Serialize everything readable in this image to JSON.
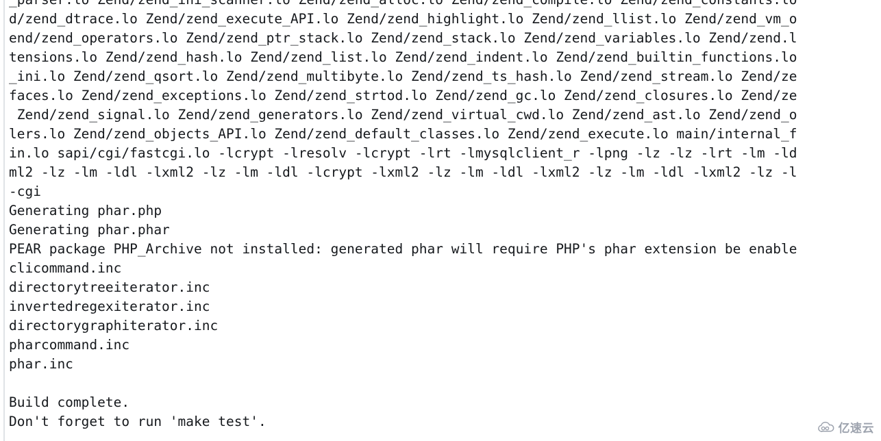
{
  "terminal": {
    "lines": [
      "_parser.lo Zend/zend_ini_scanner.lo Zend/zend_alloc.lo Zend/zend_compile.lo Zend/zend_constants.lo",
      "d/zend_dtrace.lo Zend/zend_execute_API.lo Zend/zend_highlight.lo Zend/zend_llist.lo Zend/zend_vm_o",
      "end/zend_operators.lo Zend/zend_ptr_stack.lo Zend/zend_stack.lo Zend/zend_variables.lo Zend/zend.l",
      "tensions.lo Zend/zend_hash.lo Zend/zend_list.lo Zend/zend_indent.lo Zend/zend_builtin_functions.lo",
      "_ini.lo Zend/zend_qsort.lo Zend/zend_multibyte.lo Zend/zend_ts_hash.lo Zend/zend_stream.lo Zend/ze",
      "faces.lo Zend/zend_exceptions.lo Zend/zend_strtod.lo Zend/zend_gc.lo Zend/zend_closures.lo Zend/ze",
      " Zend/zend_signal.lo Zend/zend_generators.lo Zend/zend_virtual_cwd.lo Zend/zend_ast.lo Zend/zend_o",
      "lers.lo Zend/zend_objects_API.lo Zend/zend_default_classes.lo Zend/zend_execute.lo main/internal_f",
      "in.lo sapi/cgi/fastcgi.lo -lcrypt -lresolv -lcrypt -lrt -lmysqlclient_r -lpng -lz -lz -lrt -lm -ld",
      "ml2 -lz -lm -ldl -lxml2 -lz -lm -ldl -lcrypt -lxml2 -lz -lm -ldl -lxml2 -lz -lm -ldl -lxml2 -lz -l",
      "-cgi",
      "Generating phar.php",
      "Generating phar.phar",
      "PEAR package PHP_Archive not installed: generated phar will require PHP's phar extension be enable",
      "clicommand.inc",
      "directorytreeiterator.inc",
      "invertedregexiterator.inc",
      "directorygraphiterator.inc",
      "pharcommand.inc",
      "phar.inc",
      "",
      "Build complete.",
      "Don't forget to run 'make test'."
    ]
  },
  "watermark": {
    "icon": "cloud-icon",
    "text": "亿速云",
    "color": "#8d93a0"
  },
  "colors": {
    "background": "#ffffff",
    "text": "#15181c",
    "left_rule": "#dfe3e6"
  }
}
